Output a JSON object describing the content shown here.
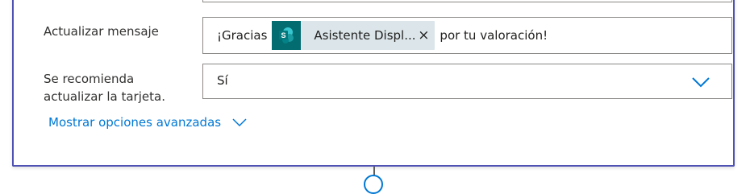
{
  "form": {
    "update_message": {
      "label": "Actualizar mensaje",
      "text_before": "¡Gracias",
      "token_label": "Asistente Displ...",
      "token_close": "×",
      "text_after": "por tu valoración!"
    },
    "update_card": {
      "label_line1": "Se recomienda",
      "label_line2": "actualizar la tarjeta.",
      "selected_value": "Sí"
    },
    "advanced_options_label": "Mostrar opciones avanzadas"
  },
  "colors": {
    "accent": "#4f52b2",
    "link": "#0078d4",
    "sharepoint_icon_bg": "#036c70",
    "token_bg": "#dce6ea"
  },
  "icons": {
    "token_icon": "sharepoint-icon",
    "dropdown": "chevron-down-icon",
    "advanced": "chevron-down-icon"
  }
}
